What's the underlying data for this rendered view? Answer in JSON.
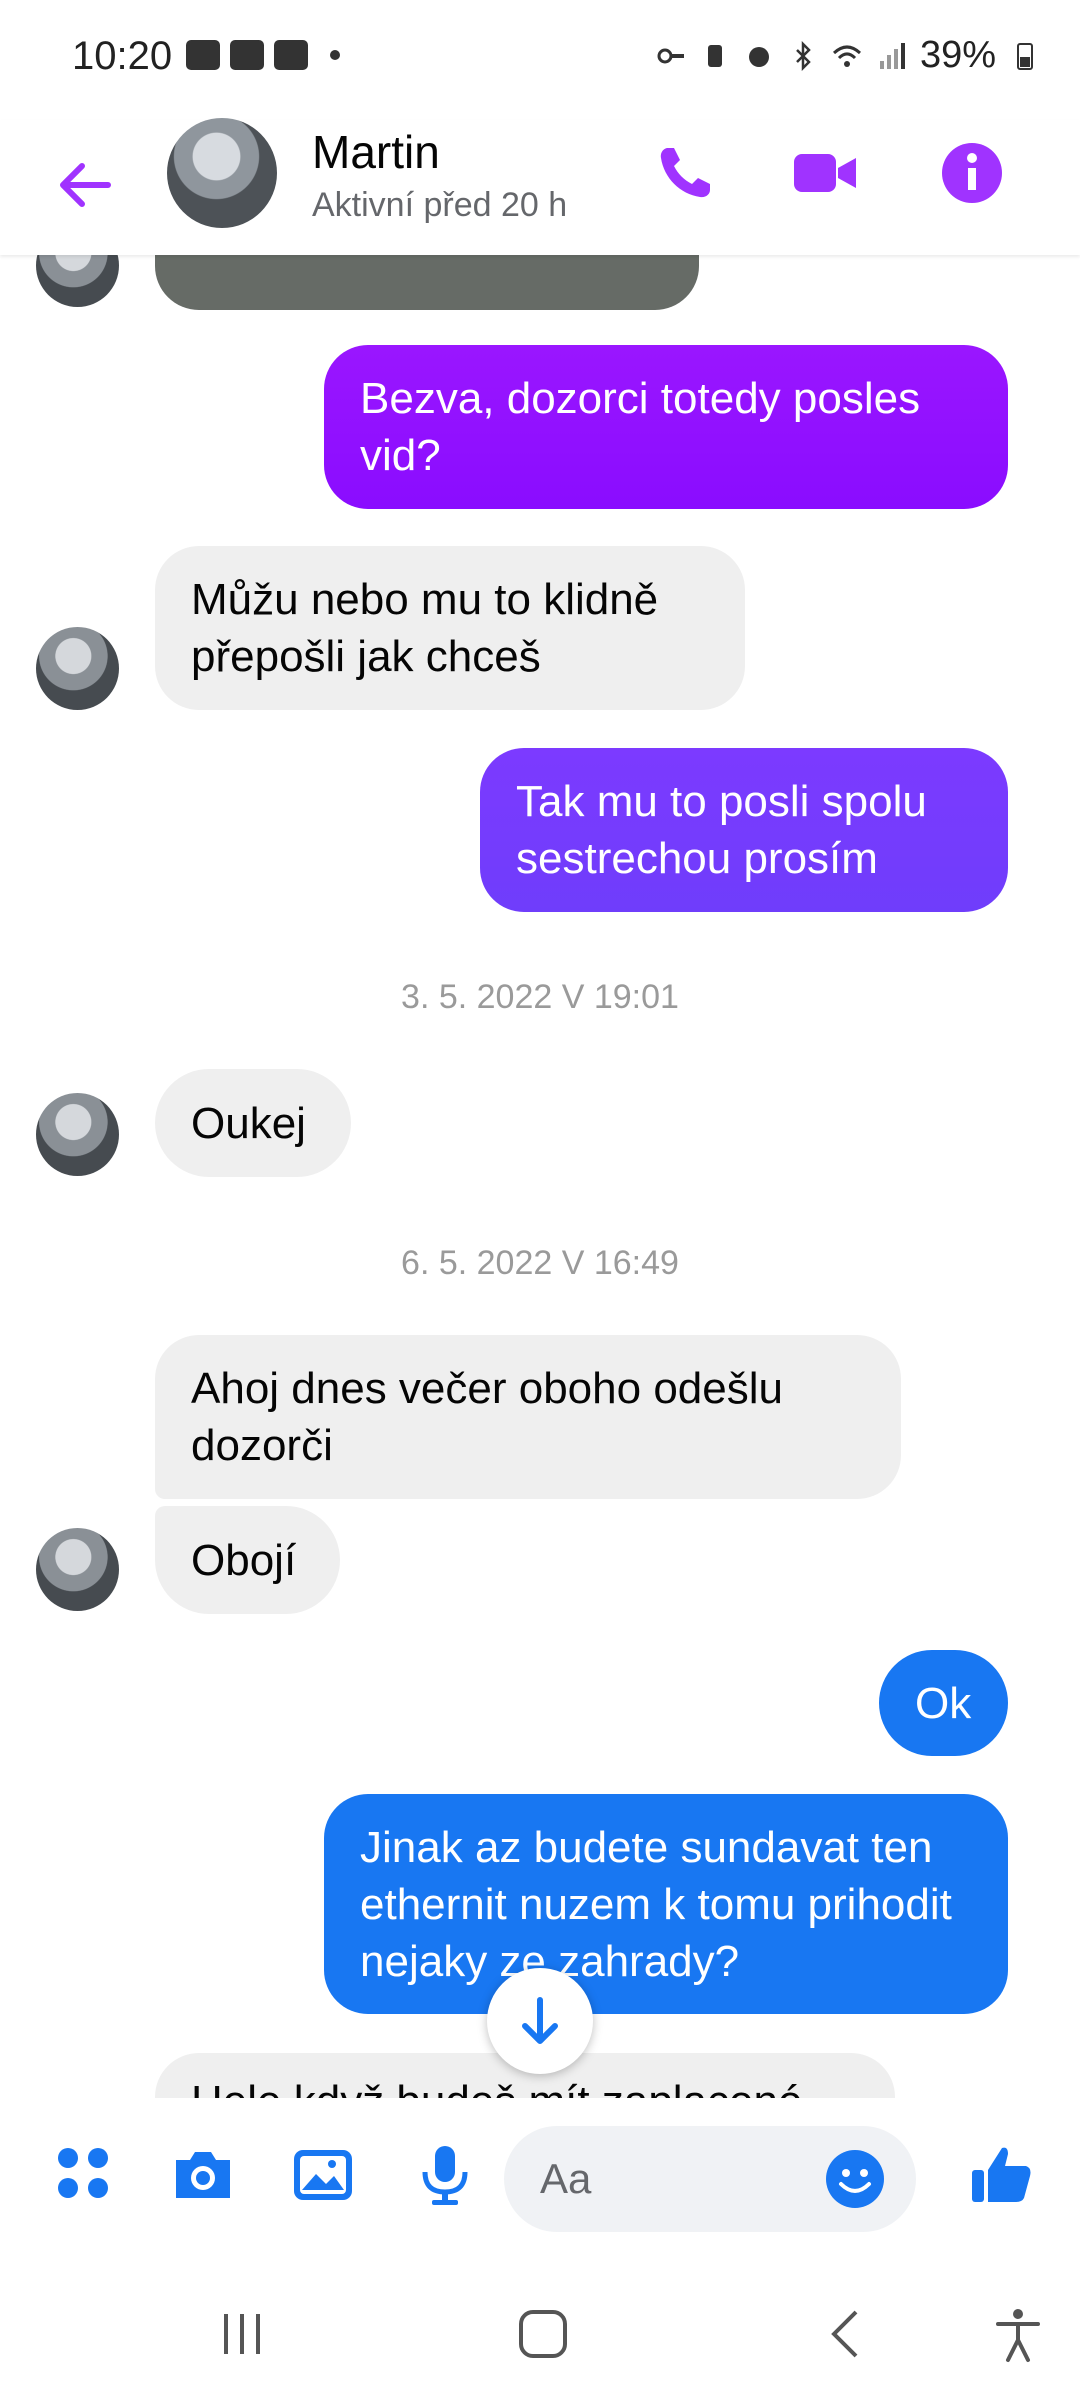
{
  "status_bar": {
    "time": "10:20",
    "battery": "39%"
  },
  "header": {
    "contact_name": "Martin",
    "contact_status": "Aktivní před 20 h"
  },
  "messages": [
    {
      "direction": "out",
      "text": "Bezva, dozorci totedy posles vid?"
    },
    {
      "direction": "in",
      "text": "Můžu nebo mu to klidně přepošli jak chceš"
    },
    {
      "direction": "out",
      "text": "Tak mu to posli spolu sestrechou prosím"
    },
    {
      "timestamp": "3. 5. 2022 V 19:01"
    },
    {
      "direction": "in",
      "text": "Oukej"
    },
    {
      "timestamp": "6. 5. 2022 V 16:49"
    },
    {
      "direction": "in",
      "text": "Ahoj dnes večer oboho odešlu dozorči"
    },
    {
      "direction": "in",
      "text": "Obojí"
    },
    {
      "direction": "out",
      "text": "Ok"
    },
    {
      "direction": "out",
      "text": "Jinak az budete sundavat ten ethernit nuzem k tomu prihodit nejaky ze zahrady?"
    },
    {
      "direction": "in",
      "text": "Hele když budeš mít zaplacené"
    }
  ],
  "composer": {
    "placeholder": "Aa"
  },
  "colors": {
    "accent_purple": "#a033ff",
    "bubble_blue": "#1877f2",
    "bubble_gray": "#efefef"
  },
  "icons": {
    "header": [
      "back-arrow-icon",
      "phone-icon",
      "video-icon",
      "info-icon"
    ],
    "composer": [
      "apps-icon",
      "camera-icon",
      "gallery-icon",
      "mic-icon",
      "emoji-icon",
      "like-icon"
    ],
    "navbar": [
      "recents-icon",
      "home-icon",
      "back-icon",
      "accessibility-icon"
    ]
  }
}
